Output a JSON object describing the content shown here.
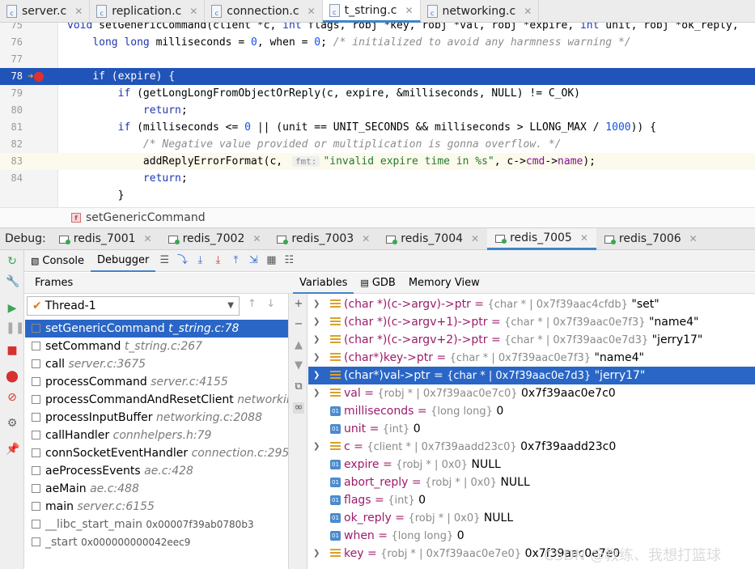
{
  "editor_tabs": [
    {
      "label": "server.c",
      "active": false
    },
    {
      "label": "replication.c",
      "active": false
    },
    {
      "label": "connection.c",
      "active": false
    },
    {
      "label": "t_string.c",
      "active": true
    },
    {
      "label": "networking.c",
      "active": false
    }
  ],
  "code_lines": [
    {
      "num": "75",
      "html": "<span class=\"kw\">void</span> setGenericCommand(client *c, <span class=\"kw\">int</span> flags, robj *key, robj *val, robj *expire, <span class=\"kw\">int</span> unit, robj *ok_reply,"
    },
    {
      "num": "76",
      "html": "    <span class=\"kw\">long long</span> milliseconds = <span class=\"numl\">0</span>, when = <span class=\"numl\">0</span>; <span class=\"cmt\">/* initialized to avoid any harmness warning */</span>"
    },
    {
      "num": "77",
      "html": ""
    },
    {
      "num": "78",
      "html": "    <span>if (expire) {</span>"
    },
    {
      "num": "79",
      "html": "        <span class=\"kw\">if</span> (getLongLongFromObjectOrReply(c, expire, &amp;milliseconds, NULL) != C_OK)"
    },
    {
      "num": "80",
      "html": "            <span class=\"kw\">return</span>;"
    },
    {
      "num": "81",
      "html": "        <span class=\"kw\">if</span> (milliseconds &lt;= <span class=\"numl\">0</span> || (unit == UNIT_SECONDS &amp;&amp; milliseconds &gt; LLONG_MAX / <span class=\"numl\">1000</span>)) {"
    },
    {
      "num": "82",
      "html": "            <span class=\"cmt\">/* Negative value provided or multiplication is gonna overflow. */</span>"
    },
    {
      "num": "83",
      "html": "            addReplyErrorFormat(c, <span class=\"hint\">fmt:</span><span class=\"str\">\"invalid expire time in %s\"</span>, c-&gt;<span class=\"fld\">cmd</span>-&gt;<span class=\"fld\">name</span>);"
    },
    {
      "num": "84",
      "html": "            <span class=\"kw\">return</span>;"
    },
    {
      "num": "",
      "html": "        }"
    }
  ],
  "breadcrumb": "setGenericCommand",
  "debug": {
    "label": "Debug:",
    "sessions": [
      {
        "label": "redis_7001",
        "active": false
      },
      {
        "label": "redis_7002",
        "active": false
      },
      {
        "label": "redis_7003",
        "active": false
      },
      {
        "label": "redis_7004",
        "active": false
      },
      {
        "label": "redis_7005",
        "active": true
      },
      {
        "label": "redis_7006",
        "active": false
      }
    ],
    "console_label": "Console",
    "debugger_label": "Debugger"
  },
  "frames": {
    "header": "Frames",
    "thread": "Thread-1",
    "items": [
      {
        "fn": "setGenericCommand",
        "loc": "t_string.c:78",
        "addr": "",
        "selected": true
      },
      {
        "fn": "setCommand",
        "loc": "t_string.c:267",
        "addr": ""
      },
      {
        "fn": "call",
        "loc": "server.c:3675",
        "addr": ""
      },
      {
        "fn": "processCommand",
        "loc": "server.c:4155",
        "addr": ""
      },
      {
        "fn": "processCommandAndResetClient",
        "loc": "networking.c",
        "addr": ""
      },
      {
        "fn": "processInputBuffer",
        "loc": "networking.c:2088",
        "addr": ""
      },
      {
        "fn": "callHandler",
        "loc": "connhelpers.h:79",
        "addr": ""
      },
      {
        "fn": "connSocketEventHandler",
        "loc": "connection.c:295",
        "addr": ""
      },
      {
        "fn": "aeProcessEvents",
        "loc": "ae.c:428",
        "addr": ""
      },
      {
        "fn": "aeMain",
        "loc": "ae.c:488",
        "addr": ""
      },
      {
        "fn": "main",
        "loc": "server.c:6155",
        "addr": ""
      },
      {
        "fn": "__libc_start_main",
        "loc": "",
        "addr": "0x00007f39ab0780b3",
        "dim": true
      },
      {
        "fn": "_start",
        "loc": "",
        "addr": "0x000000000042eec9",
        "dim": true
      }
    ]
  },
  "vars": {
    "tabs": [
      "Variables",
      "GDB",
      "Memory View"
    ],
    "rows": [
      {
        "name": "(char *)(c->argv)->ptr",
        "type": "{char * | 0x7f39aac4cfdb}",
        "value": "\"set\"",
        "icon": "watch",
        "expand": true
      },
      {
        "name": "(char *)(c->argv+1)->ptr",
        "type": "{char * | 0x7f39aac0e7f3}",
        "value": "\"name4\"",
        "icon": "watch",
        "expand": true
      },
      {
        "name": "(char *)(c->argv+2)->ptr",
        "type": "{char * | 0x7f39aac0e7d3}",
        "value": "\"jerry17\"",
        "icon": "watch",
        "expand": true
      },
      {
        "name": "(char*)key->ptr",
        "type": "{char * | 0x7f39aac0e7f3}",
        "value": "\"name4\"",
        "icon": "watch",
        "expand": true
      },
      {
        "name": "(char*)val->ptr",
        "type": "{char * | 0x7f39aac0e7d3}",
        "value": "\"jerry17\"",
        "icon": "watch",
        "expand": true,
        "selected": true
      },
      {
        "name": "val",
        "type": "{robj * | 0x7f39aac0e7c0}",
        "value": "0x7f39aac0e7c0",
        "icon": "watch",
        "expand": true
      },
      {
        "name": "milliseconds",
        "type": "{long long}",
        "value": "0",
        "icon": "num",
        "expand": false
      },
      {
        "name": "unit",
        "type": "{int}",
        "value": "0",
        "icon": "num",
        "expand": false
      },
      {
        "name": "c",
        "type": "{client * | 0x7f39aadd23c0}",
        "value": "0x7f39aadd23c0",
        "icon": "watch",
        "expand": true
      },
      {
        "name": "expire",
        "type": "{robj * | 0x0}",
        "value": "NULL",
        "icon": "num",
        "expand": false
      },
      {
        "name": "abort_reply",
        "type": "{robj * | 0x0}",
        "value": "NULL",
        "icon": "num",
        "expand": false
      },
      {
        "name": "flags",
        "type": "{int}",
        "value": "0",
        "icon": "num",
        "expand": false
      },
      {
        "name": "ok_reply",
        "type": "{robj * | 0x0}",
        "value": "NULL",
        "icon": "num",
        "expand": false
      },
      {
        "name": "when",
        "type": "{long long}",
        "value": "0",
        "icon": "num",
        "expand": false
      },
      {
        "name": "key",
        "type": "{robj * | 0x7f39aac0e7e0}",
        "value": "0x7f39aac0e7e0",
        "icon": "watch",
        "expand": true
      }
    ]
  },
  "watermark": "CSDN @教练、我想打篮球"
}
